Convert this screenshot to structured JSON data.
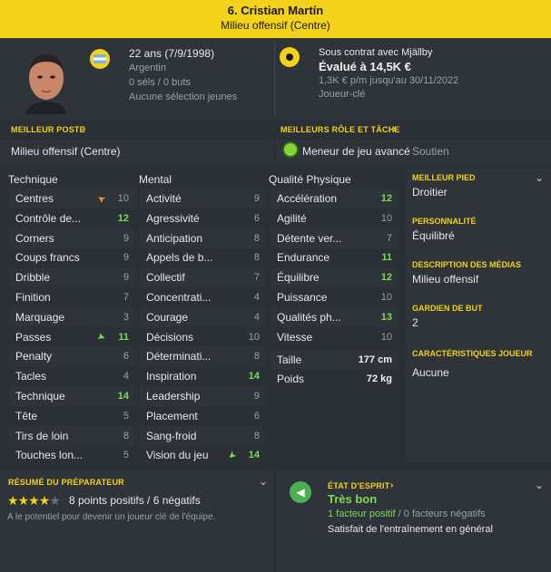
{
  "header": {
    "title": "6. Cristian Martín",
    "position": "Milieu offensif (Centre)"
  },
  "profile": {
    "age": "22 ans (7/9/1998)",
    "nation": "Argentin",
    "caps": "0 séls / 0 buts",
    "youth": "Aucune sélection jeunes",
    "contract": "Sous contrat avec Mjällby",
    "value": "Évalué à 14,5K €",
    "wage": "1,3K € p/m jusqu'au 30/11/2022",
    "status": "Joueur-clé"
  },
  "best_position": {
    "label": "MEILLEUR POSTE",
    "value": "Milieu offensif (Centre)"
  },
  "best_role": {
    "label": "MEILLEURS RÔLE ET TÂCHE",
    "role": "Meneur de jeu avancé",
    "duty": "Soutien"
  },
  "technique": {
    "title": "Technique",
    "rows": [
      {
        "label": "Centres",
        "value": "10"
      },
      {
        "label": "Contrôle de...",
        "value": "12"
      },
      {
        "label": "Corners",
        "value": "9"
      },
      {
        "label": "Coups francs",
        "value": "9"
      },
      {
        "label": "Dribble",
        "value": "9"
      },
      {
        "label": "Finition",
        "value": "7"
      },
      {
        "label": "Marquage",
        "value": "3"
      },
      {
        "label": "Passes",
        "value": "11"
      },
      {
        "label": "Penalty",
        "value": "6"
      },
      {
        "label": "Tacles",
        "value": "4"
      },
      {
        "label": "Technique",
        "value": "14"
      },
      {
        "label": "Tête",
        "value": "5"
      },
      {
        "label": "Tirs de loin",
        "value": "8"
      },
      {
        "label": "Touches lon...",
        "value": "5"
      }
    ]
  },
  "mental": {
    "title": "Mental",
    "rows": [
      {
        "label": "Activité",
        "value": "9"
      },
      {
        "label": "Agressivité",
        "value": "6"
      },
      {
        "label": "Anticipation",
        "value": "8"
      },
      {
        "label": "Appels de b...",
        "value": "8"
      },
      {
        "label": "Collectif",
        "value": "7"
      },
      {
        "label": "Concentrati...",
        "value": "4"
      },
      {
        "label": "Courage",
        "value": "4"
      },
      {
        "label": "Décisions",
        "value": "10"
      },
      {
        "label": "Déterminati...",
        "value": "8"
      },
      {
        "label": "Inspiration",
        "value": "14"
      },
      {
        "label": "Leadership",
        "value": "9"
      },
      {
        "label": "Placement",
        "value": "6"
      },
      {
        "label": "Sang-froid",
        "value": "8"
      },
      {
        "label": "Vision du jeu",
        "value": "14"
      }
    ]
  },
  "physical": {
    "title": "Qualité Physique",
    "rows": [
      {
        "label": "Accélération",
        "value": "12"
      },
      {
        "label": "Agilité",
        "value": "10"
      },
      {
        "label": "Détente ver...",
        "value": "7"
      },
      {
        "label": "Endurance",
        "value": "11"
      },
      {
        "label": "Équilibre",
        "value": "12"
      },
      {
        "label": "Puissance",
        "value": "10"
      },
      {
        "label": "Qualités ph...",
        "value": "13"
      },
      {
        "label": "Vitesse",
        "value": "10"
      }
    ],
    "height_label": "Taille",
    "height": "177 cm",
    "weight_label": "Poids",
    "weight": "72 kg"
  },
  "side": {
    "foot_label": "MEILLEUR PIED",
    "foot": "Droitier",
    "personality_label": "PERSONNALITÉ",
    "personality": "Équilibré",
    "media_label": "DESCRIPTION DES MÉDIAS",
    "media": "Milieu offensif",
    "gk_label": "GARDIEN DE BUT",
    "gk": "2",
    "traits_label": "CARACTÉRISTIQUES JOUEUR",
    "traits": "Aucune"
  },
  "coach": {
    "label": "RÉSUMÉ DU PRÉPARATEUR",
    "rating": 4,
    "rating_max": 5,
    "points": "8 points positifs / 6 négatifs",
    "summary": "A le potentiel pour devenir un joueur clé de l'équipe."
  },
  "mood": {
    "label": "ÉTAT D'ESPRIT",
    "value": "Très bon",
    "positive": "1 facteur positif",
    "sep": " / ",
    "negative": "0 facteurs négatifs",
    "detail": "Satisfait de l'entraînement en général"
  },
  "colors": {
    "accent": "#f2d21b",
    "good": "#7ed957",
    "bg": "#2b2f36"
  }
}
